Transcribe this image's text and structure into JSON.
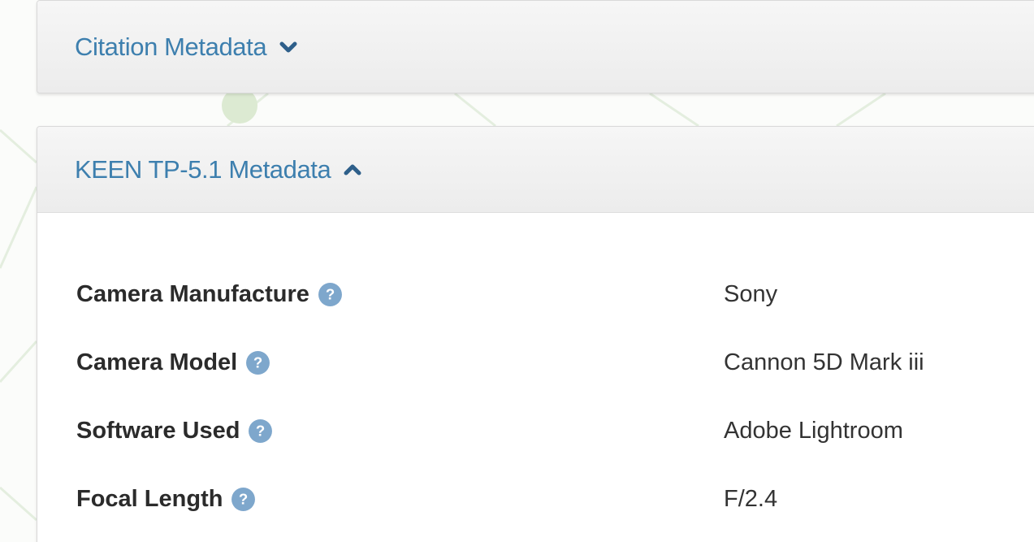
{
  "citation_panel": {
    "title": "Citation Metadata",
    "toggle_icon": "chevron-down-icon"
  },
  "keen_panel": {
    "title": "KEEN TP-5.1 Metadata",
    "toggle_icon": "chevron-up-icon",
    "fields": [
      {
        "label": "Camera Manufacture",
        "value": "Sony"
      },
      {
        "label": "Camera Model",
        "value": "Cannon 5D Mark iii"
      },
      {
        "label": "Software Used",
        "value": "Adobe Lightroom"
      },
      {
        "label": "Focal Length",
        "value": "F/2.4"
      }
    ]
  },
  "colors": {
    "title_link": "#3d7fae",
    "help_icon": "#7ea7cc",
    "label_text": "#2b2b2b",
    "heading_bg": "#efefef"
  }
}
